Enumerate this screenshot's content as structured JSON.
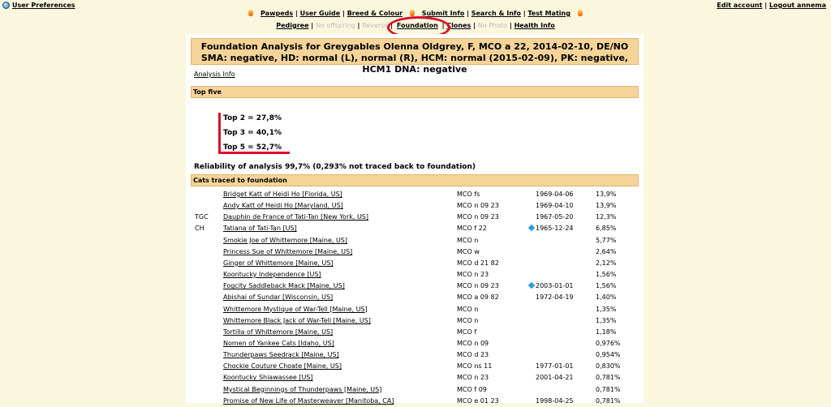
{
  "top_bar": {
    "user_preferences": "User Preferences",
    "edit_account": "Edit account",
    "separator": "|",
    "logout": "Logout annema"
  },
  "nav_primary": [
    "Pawpeds",
    "User Guide",
    "Breed & Colour",
    "Submit Info",
    "Search & Info",
    "Test Mating"
  ],
  "nav_secondary": [
    {
      "label": "Pedigree",
      "enabled": true
    },
    {
      "label": "No offspring",
      "enabled": false
    },
    {
      "label": "Reverse",
      "enabled": false
    },
    {
      "label": "Foundation",
      "enabled": true,
      "highlighted": true
    },
    {
      "label": "Clones",
      "enabled": true
    },
    {
      "label": "No Photo",
      "enabled": false
    },
    {
      "label": "Health Info",
      "enabled": true
    }
  ],
  "header": {
    "line1": "Foundation Analysis for Greygables Olenna Oldgrey, F, MCO a 22, 2014-02-10, DE/NO",
    "line2": "SMA: negative, HD: normal (L), normal (R), HCM: normal (2015-02-09), PK: negative, HCM1 DNA: negative"
  },
  "analysis_info": "Analysis Info",
  "top_five": {
    "heading": "Top five",
    "lines": [
      "Top 2 = 27,8%",
      "Top 3 = 40,1%",
      "Top 5 = 52,7%"
    ]
  },
  "reliability": "Reliability of analysis 99,7% (0,293% not traced back to foundation)",
  "cats_heading": "Cats traced to foundation",
  "cats": [
    {
      "title": "",
      "name": "Bridget Katt of Heidi Ho [Florida, US]",
      "breed": "MCO fs",
      "marker": false,
      "date": "1969-04-06",
      "pct": "13,9%"
    },
    {
      "title": "",
      "name": "Andy Katt of Heidi Ho [Maryland, US]",
      "breed": "MCO n 09 23",
      "marker": false,
      "date": "1969-04-10",
      "pct": "13,9%"
    },
    {
      "title": "TGC",
      "name": "Dauphin de France of Tati-Tan [New York, US]",
      "breed": "MCO n 09 23",
      "marker": false,
      "date": "1967-05-20",
      "pct": "12,3%"
    },
    {
      "title": "CH",
      "name": "Tatiana of Tati-Tan [US]",
      "breed": "MCO f 22",
      "marker": true,
      "date": "1965-12-24",
      "pct": "6,85%"
    },
    {
      "title": "",
      "name": "Smokie Joe of Whittemore [Maine, US]",
      "breed": "MCO n",
      "marker": false,
      "date": "",
      "pct": "5,77%"
    },
    {
      "title": "",
      "name": "Princess Sue of Whittemore [Maine, US]",
      "breed": "MCO w",
      "marker": false,
      "date": "",
      "pct": "2,64%"
    },
    {
      "title": "",
      "name": "Ginger of Whittemore [Maine, US]",
      "breed": "MCO d 21 82",
      "marker": false,
      "date": "",
      "pct": "2,12%"
    },
    {
      "title": "",
      "name": "Koontucky Independence [US]",
      "breed": "MCO n 23",
      "marker": false,
      "date": "",
      "pct": "1,56%"
    },
    {
      "title": "",
      "name": "Fogcity Saddleback Mack [Maine, US]",
      "breed": "MCO n 09 23",
      "marker": true,
      "date": "2003-01-01",
      "pct": "1,56%"
    },
    {
      "title": "",
      "name": "Abishai of Sundar [Wisconsin, US]",
      "breed": "MCO a 09 82",
      "marker": false,
      "date": "1972-04-19",
      "pct": "1,40%"
    },
    {
      "title": "",
      "name": "Whittemore Mystique of War-Tell [Maine, US]",
      "breed": "MCO n",
      "marker": false,
      "date": "",
      "pct": "1,35%"
    },
    {
      "title": "",
      "name": "Whittemore Black Jack of War-Tell [Maine, US]",
      "breed": "MCO n",
      "marker": false,
      "date": "",
      "pct": "1,35%"
    },
    {
      "title": "",
      "name": "Tortilla of Whittemore [Maine, US]",
      "breed": "MCO f",
      "marker": false,
      "date": "",
      "pct": "1,18%"
    },
    {
      "title": "",
      "name": "Nomen of Yankee Cats [Idaho, US]",
      "breed": "MCO n 09",
      "marker": false,
      "date": "",
      "pct": "0,976%"
    },
    {
      "title": "",
      "name": "Thunderpaws Seedrack [Maine, US]",
      "breed": "MCO d 23",
      "marker": false,
      "date": "",
      "pct": "0,954%"
    },
    {
      "title": "",
      "name": "Chockie Couture Choate [Maine, US]",
      "breed": "MCO ns 11",
      "marker": false,
      "date": "1977-01-01",
      "pct": "0,830%"
    },
    {
      "title": "",
      "name": "Koontucky Shiawassee [US]",
      "breed": "MCO n 23",
      "marker": false,
      "date": "2001-04-21",
      "pct": "0,781%"
    },
    {
      "title": "",
      "name": "Mystical Beginnings of Thunderpaws [Maine, US]",
      "breed": "MCO f 09",
      "marker": false,
      "date": "",
      "pct": "0,781%"
    },
    {
      "title": "",
      "name": "Promise of New Life of Masterweaver [Manitoba, CA]",
      "breed": "MCO e 01 23",
      "marker": false,
      "date": "1998-04-25",
      "pct": "0,781%"
    }
  ],
  "colors": {
    "page_background": "#fbf7df",
    "header_background": "#f5d49a",
    "highlight_red": "#d8102b",
    "marker_blue": "#2a9fd6"
  }
}
